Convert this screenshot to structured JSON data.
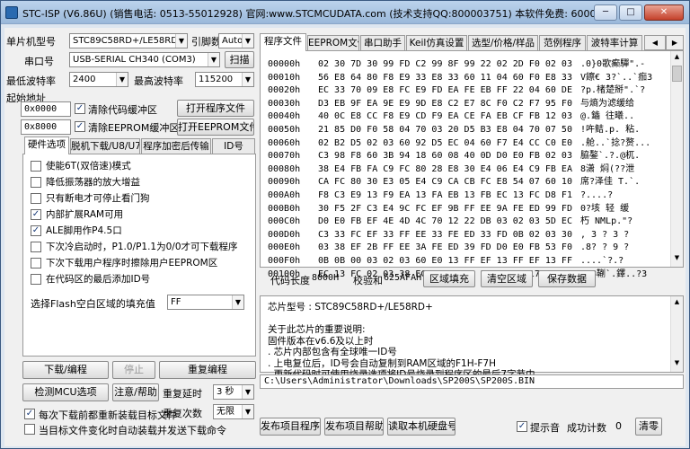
{
  "window": {
    "title": "STC-ISP (V6.86U) (销售电话: 0513-55012928) 官网:www.STCMCUDATA.com  (技术支持QQ:800003751) 本软件免费: 6000元(可免试…",
    "min": "─",
    "max": "□",
    "close": "✕"
  },
  "left": {
    "mcu_label": "单片机型号",
    "mcu_value": "STC89C58RD+/LE58RD+",
    "pins_label": "引脚数",
    "pins_value": "Auto",
    "port_label": "串口号",
    "port_value": "USB-SERIAL CH340 (COM3)",
    "scan_button": "扫描",
    "min_baud_label": "最低波特率",
    "min_baud_value": "2400",
    "max_baud_label": "最高波特率",
    "max_baud_value": "115200",
    "start_addr_label": "起始地址",
    "addr1": "0x0000",
    "addr1_check_label": "清除代码缓冲区",
    "open_program_button": "打开程序文件",
    "addr2": "0x8000",
    "addr2_check_label": "清除EEPROM缓冲区",
    "open_eeprom_button": "打开EEPROM文件",
    "tabs": [
      "硬件选项",
      "脱机下载/U8/U7",
      "程序加密后传输",
      "ID号"
    ],
    "options": [
      {
        "label": "使能6T(双倍速)模式",
        "checked": false
      },
      {
        "label": "降低振荡器的放大增益",
        "checked": false
      },
      {
        "label": "只有断电才可停止看门狗",
        "checked": false
      },
      {
        "label": "内部扩展RAM可用",
        "checked": true
      },
      {
        "label": "ALE脚用作P4.5口",
        "checked": true
      },
      {
        "label": "下次冷启动时，P1.0/P1.1为0/0才可下载程序",
        "checked": false
      },
      {
        "label": "下次下载用户程序时擦除用户EEPROM区",
        "checked": false
      },
      {
        "label": "在代码区的最后添加ID号",
        "checked": false
      }
    ],
    "fill_label": "选择Flash空白区域的填充值",
    "fill_value": "FF",
    "download_button": "下载/编程",
    "stop_button": "停止",
    "reprogram_button": "重复编程",
    "check_mcu_button": "检测MCU选项",
    "help_button": "注意/帮助",
    "repeat_delay_label": "重复延时",
    "repeat_delay_value": "3 秒",
    "reload_label": "每次下载前都重新装载目标文件",
    "reload_checked": true,
    "repeat_count_label": "重复次数",
    "repeat_count_value": "无限",
    "auto_send_label": "当目标文件变化时自动装载并发送下载命令",
    "auto_send_checked": false
  },
  "right": {
    "tabs": [
      "程序文件",
      "EEPROM文件",
      "串口助手",
      "Keil仿真设置",
      "选型/价格/样品",
      "范例程序",
      "波特率计算"
    ],
    "hex_rows": [
      {
        "addr": "00000h",
        "bytes": "02 30 7D 30 99 FD C2 99 8F 99 22 02 2D F0 02 03",
        "ascii": ".0}0歌癫驒\".-"
      },
      {
        "addr": "00010h",
        "bytes": "56 E8 64 80 F8 E9 33 E8 33 60 11 04 60 F0 E8 33",
        "ascii": "V鑔€ 3?`..`痂3"
      },
      {
        "addr": "00020h",
        "bytes": "EC 33 70 09 E8 FC E9 FD EA FE EB FF 22 04 60 DE",
        "ascii": "?p.楮楚掰\".`?"
      },
      {
        "addr": "00030h",
        "bytes": "D3 EB 9F EA 9E E9 9D E8 C2 E7 8C F0 C2 F7 95 F0",
        "ascii": "与熵为滤缓给"
      },
      {
        "addr": "00040h",
        "bytes": "40 0C E8 CC F8 E9 CD F9 EA CE FA EB CF FB 12 03",
        "ascii": "@.鑡 往曦.."
      },
      {
        "addr": "00050h",
        "bytes": "21 85 D0 F0 58 04 70 03 20 D5 B3 E8 04 70 07 50",
        "ascii": "!吘鲒.p. 粘."
      },
      {
        "addr": "00060h",
        "bytes": "02 B2 D5 02 03 60 92 D5 EC 04 60 F7 E4 CC C0 E0",
        "ascii": ".舱..`捻?赘..."
      },
      {
        "addr": "00070h",
        "bytes": "C3 98 F8 60 3B 94 18 60 08 40 0D D0 E0 FB 02 03",
        "ascii": "脇鏊`.?.@杌."
      },
      {
        "addr": "00080h",
        "bytes": "38 E4 FB FA C9 FC 80 28 E8 30 E4 06 E4 C9 FB EA",
        "ascii": "8潇 焖(??泄"
      },
      {
        "addr": "00090h",
        "bytes": "CA FC 80 30 E3 05 E4 C9 CA CB FC E8 54 07 60 10",
        "ascii": "席?泽佳 T.`."
      },
      {
        "addr": "000A0h",
        "bytes": "F8 C3 E9 13 F9 EA 13 FA EB 13 FB EC 13 FC D8 F1",
        "ascii": "?....?"
      },
      {
        "addr": "000B0h",
        "bytes": "30 F5 2F C3 E4 9C FC EF 9B FF EE 9A FE ED 99 FD",
        "ascii": "0?垓 轻 缓"
      },
      {
        "addr": "000C0h",
        "bytes": "D0 E0 FB EF 4E 4D 4C 70 12 22 DB 03 02 03 5D EC",
        "ascii": "朽 NMLp.\"?"
      },
      {
        "addr": "000D0h",
        "bytes": "C3 33 FC EF 33 FF EE 33 FE ED 33 FD 0B 02 03 30",
        "ascii": ", 3 ? 3 ?"
      },
      {
        "addr": "000E0h",
        "bytes": "03 38 EF 2B FF EE 3A FE ED 39 FD D0 E0 FB 53 F0",
        "ascii": ".8? ? 9 ?"
      },
      {
        "addr": "000F0h",
        "bytes": "0B 0B 00 03 02 03 60 E0 13 FF EF 13 FF EF 13 FF",
        "ascii": "....`?.?"
      },
      {
        "addr": "00100h",
        "bytes": "EC 13 FC 02 03 38 EC 4D 60 11 E8 49 17 17 E8 33",
        "ascii": "??8鞩`.鐸..?3"
      }
    ],
    "code_len_label": "代码长度",
    "code_len_value": "8000H",
    "checksum_label": "校验和",
    "checksum_value": "625AFAH",
    "fill_area_button": "区域填充",
    "clear_area_button": "清空区域",
    "save_data_button": "保存数据",
    "chip_info": [
      "芯片型号 : STC89C58RD+/LE58RD+",
      "",
      "关于此芯片的重要说明:",
      "  固件版本在v6.6及以上时",
      "  . 芯片内部包含有全球唯一ID号",
      "  . 上电复位后，ID号会自动复制到RAM区域的F1H-F7H",
      "  . 更新代码时可使用烧录选项将ID号烧录到程序区的最后7字节中"
    ],
    "file_path": "C:\\Users\\Administrator\\Downloads\\SP200S\\SP200S.BIN",
    "publish_button": "发布项目程序",
    "publish_help_button": "发布项目帮助",
    "read_disk_button": "读取本机硬盘号",
    "sound_label": "提示音",
    "sound_checked": true,
    "success_count_label": "成功计数",
    "success_count_value": "0",
    "clear_count_button": "清零"
  }
}
